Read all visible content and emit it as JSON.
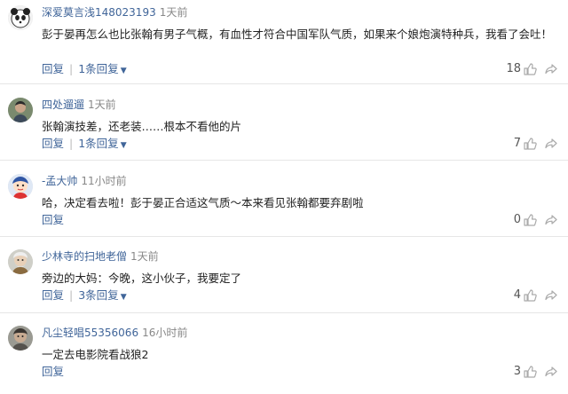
{
  "comments": [
    {
      "user": "深爱莫言浅148023193",
      "time": "1天前",
      "text": "彭于晏再怎么也比张翰有男子气概，有血性才符合中国军队气质，如果来个娘炮演特种兵，我看了会吐！",
      "reply_label": "回复",
      "sub_replies": "1条回复",
      "likes": "18",
      "avatar_icon": "panda-avatar-icon"
    },
    {
      "user": "四处遛遛",
      "time": "1天前",
      "text": "张翰演技差，还老装……根本不看他的片",
      "reply_label": "回复",
      "sub_replies": "1条回复",
      "likes": "7",
      "avatar_icon": "person-avatar-icon"
    },
    {
      "user": "-孟大帅",
      "time": "11小时前",
      "text": "哈，决定看去啦！彭于晏正合适这气质～本来看见张翰都要弃剧啦",
      "reply_label": "回复",
      "sub_replies": "",
      "likes": "0",
      "avatar_icon": "cartoon-avatar-icon"
    },
    {
      "user": "少林寺的扫地老僧",
      "time": "1天前",
      "text": "旁边的大妈：今晚，这小伙子，我要定了",
      "reply_label": "回复",
      "sub_replies": "3条回复",
      "likes": "4",
      "avatar_icon": "monk-avatar-icon"
    },
    {
      "user": "凡尘轻唱55356066",
      "time": "16小时前",
      "text": "一定去电影院看战狼2",
      "reply_label": "回复",
      "sub_replies": "",
      "likes": "3",
      "avatar_icon": "face-avatar-icon"
    }
  ],
  "colors": {
    "link": "#406599",
    "time": "#888888",
    "text": "#222222",
    "separator": "#e6e6e6"
  }
}
